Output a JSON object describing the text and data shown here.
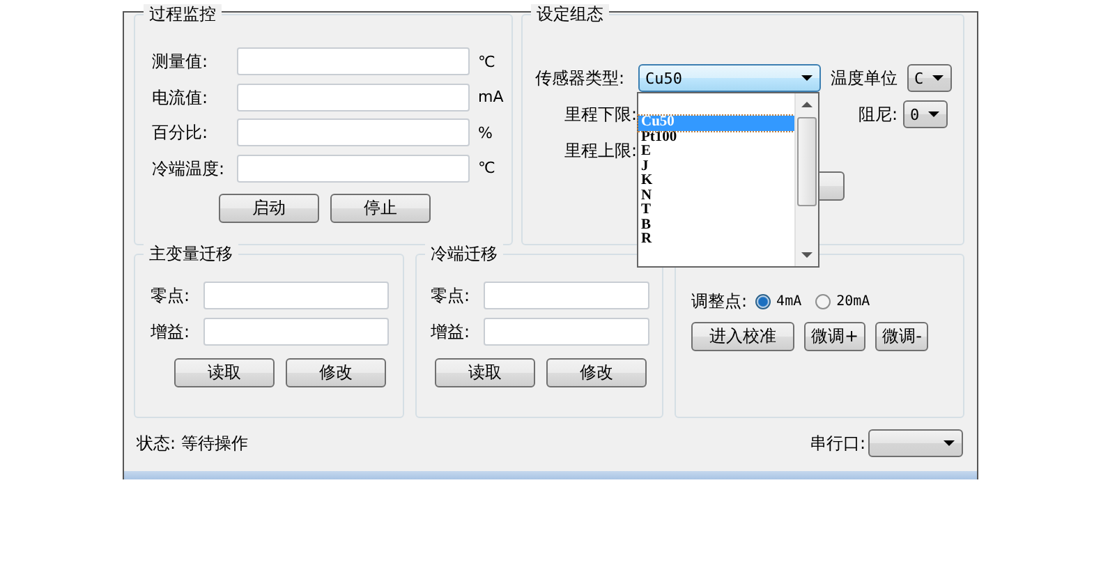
{
  "process_monitor": {
    "title": "过程监控",
    "rows": [
      {
        "label": "测量值:",
        "unit": "℃"
      },
      {
        "label": "电流值:",
        "unit": "mA"
      },
      {
        "label": "百分比:",
        "unit": "%"
      },
      {
        "label": "冷端温度:",
        "unit": "℃"
      }
    ],
    "buttons": [
      "启动",
      "停止"
    ]
  },
  "config": {
    "title": "设定组态",
    "sensor_type": {
      "label": "传感器类型:",
      "value": "Cu50",
      "expanded": true,
      "options": [
        {
          "label": "Cu50",
          "selected": true
        },
        {
          "label": "Pt100",
          "selected": false
        },
        {
          "label": "E",
          "selected": false
        },
        {
          "label": "J",
          "selected": false
        },
        {
          "label": "K",
          "selected": false
        },
        {
          "label": "N",
          "selected": false
        },
        {
          "label": "T",
          "selected": false
        },
        {
          "label": "B",
          "selected": false
        },
        {
          "label": "R",
          "selected": false
        }
      ]
    },
    "temp_unit": {
      "label": "温度单位",
      "value": "C"
    },
    "lower_range": {
      "label": "里程下限:"
    },
    "upper_range": {
      "label": "里程上限:"
    },
    "damping": {
      "label": "阻尼:",
      "value": "0"
    }
  },
  "primary_migration": {
    "title": "主变量迁移",
    "fields": [
      {
        "label": "零点:"
      },
      {
        "label": "增益:"
      }
    ],
    "buttons": [
      "读取",
      "修改"
    ]
  },
  "cold_junction_migration": {
    "title": "冷端迁移",
    "fields": [
      {
        "label": "零点:"
      },
      {
        "label": "增益:"
      }
    ],
    "buttons": [
      "读取",
      "修改"
    ]
  },
  "output_calibration": {
    "adjust_point": {
      "label": "调整点:",
      "options": [
        {
          "label": "4mA",
          "selected": true
        },
        {
          "label": "20mA",
          "selected": false
        }
      ]
    },
    "buttons": [
      "进入校准",
      "微调+",
      "微调-"
    ]
  },
  "status_bar": {
    "status": "状态: 等待操作",
    "serial_port": {
      "label": "串行口:"
    }
  }
}
